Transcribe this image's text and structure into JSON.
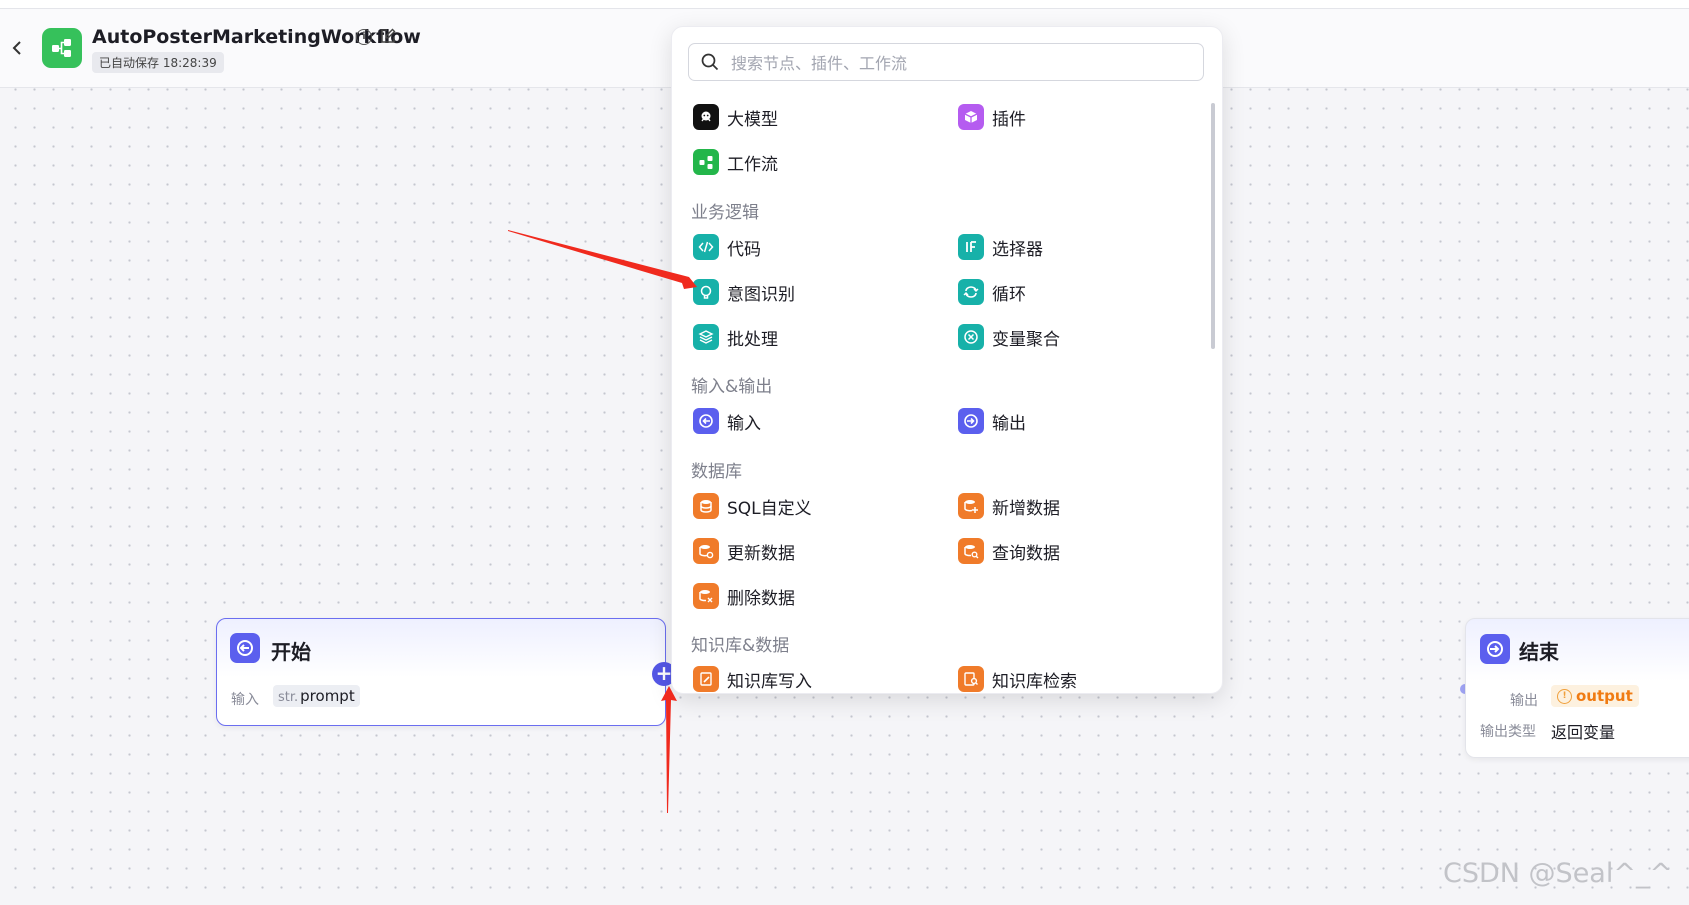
{
  "header": {
    "title": "AutoPosterMarketingWorkflow",
    "autosave": "已自动保存 18:28:39"
  },
  "nodes": {
    "start": {
      "title": "开始",
      "input_label": "输入",
      "param_type": "str.",
      "param_name": "prompt"
    },
    "end": {
      "title": "结束",
      "output_label": "输出",
      "output_var": "output",
      "output_type_label": "输出类型",
      "output_type_value": "返回变量"
    }
  },
  "panel": {
    "search_placeholder": "搜索节点、插件、工作流",
    "top_items": [
      {
        "label": "大模型",
        "icon": "llm-icon",
        "color": "#1d1d25"
      },
      {
        "label": "插件",
        "icon": "plugin-icon",
        "color": "#b55cf0"
      },
      {
        "label": "工作流",
        "icon": "workflow-icon",
        "color": "#23b64a"
      }
    ],
    "sections": [
      {
        "title": "业务逻辑",
        "items": [
          {
            "label": "代码",
            "icon": "code-icon",
            "color": "#17b1a9"
          },
          {
            "label": "选择器",
            "icon": "if-icon",
            "color": "#17b1a9"
          },
          {
            "label": "意图识别",
            "icon": "intent-icon",
            "color": "#17b1a9"
          },
          {
            "label": "循环",
            "icon": "loop-icon",
            "color": "#17b1a9"
          },
          {
            "label": "批处理",
            "icon": "batch-icon",
            "color": "#17b1a9"
          },
          {
            "label": "变量聚合",
            "icon": "aggregate-icon",
            "color": "#17b1a9"
          }
        ]
      },
      {
        "title": "输入&输出",
        "items": [
          {
            "label": "输入",
            "icon": "input-icon",
            "color": "#5b5fee"
          },
          {
            "label": "输出",
            "icon": "output-icon",
            "color": "#5b5fee"
          }
        ]
      },
      {
        "title": "数据库",
        "items": [
          {
            "label": "SQL自定义",
            "icon": "sql-icon",
            "color": "#f07b2a"
          },
          {
            "label": "新增数据",
            "icon": "db-add-icon",
            "color": "#f07b2a"
          },
          {
            "label": "更新数据",
            "icon": "db-update-icon",
            "color": "#f07b2a"
          },
          {
            "label": "查询数据",
            "icon": "db-query-icon",
            "color": "#f07b2a"
          },
          {
            "label": "删除数据",
            "icon": "db-delete-icon",
            "color": "#f07b2a"
          }
        ]
      },
      {
        "title": "知识库&数据",
        "items": [
          {
            "label": "知识库写入",
            "icon": "kb-write-icon",
            "color": "#f07b2a"
          },
          {
            "label": "知识库检索",
            "icon": "kb-search-icon",
            "color": "#f07b2a"
          }
        ]
      }
    ]
  },
  "watermark": "CSDN @Seal^_^",
  "colors": {
    "accent": "#5b5fee",
    "annotation_arrow": "#f02a1e",
    "brand_green": "#36c15b"
  }
}
